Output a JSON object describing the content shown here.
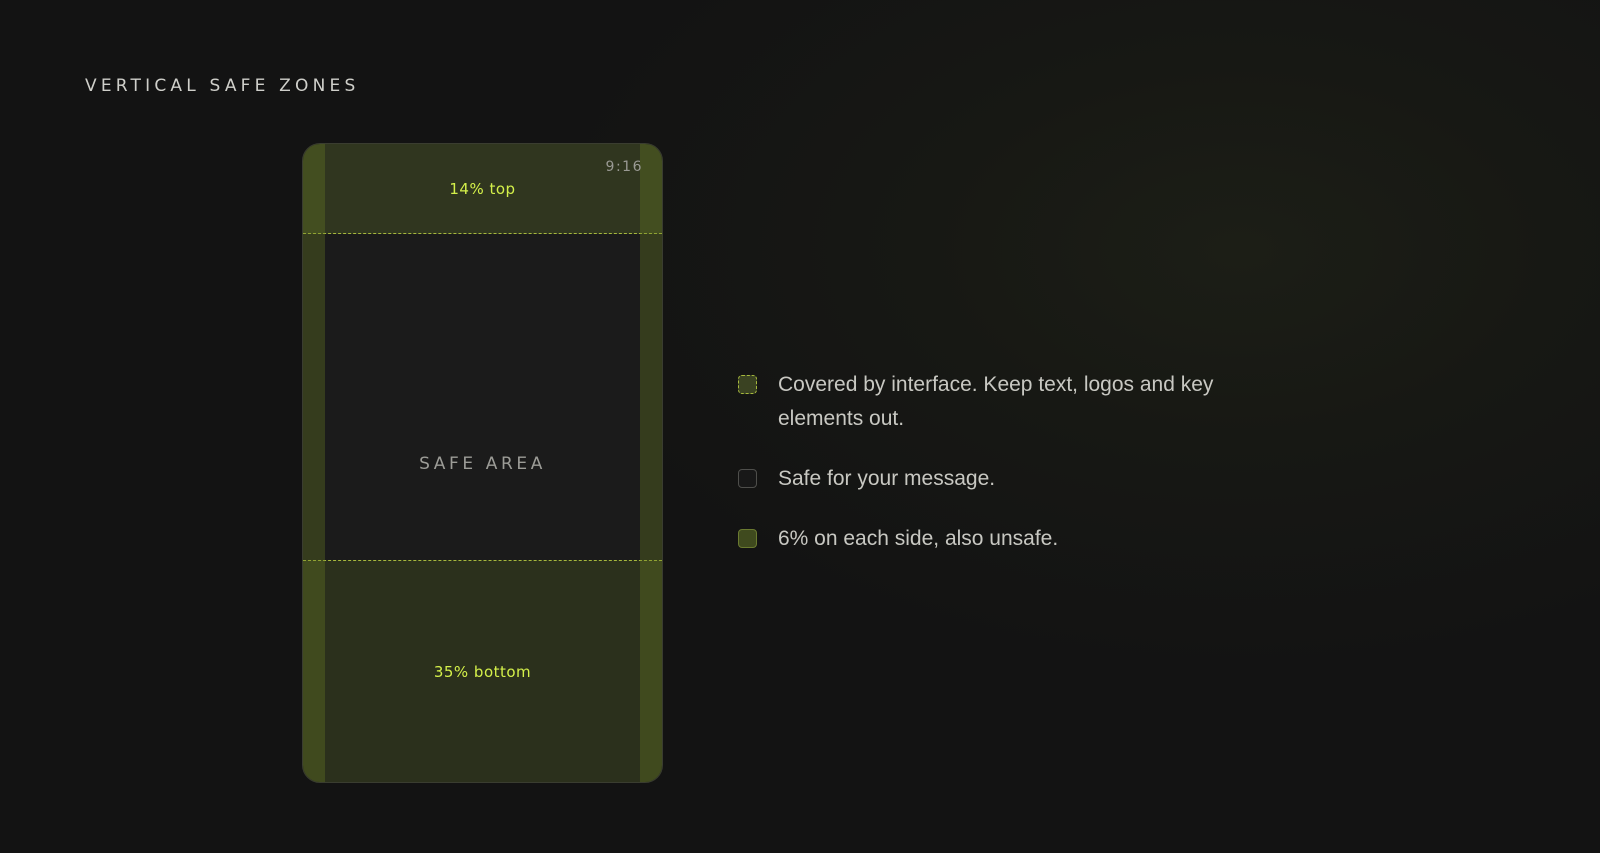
{
  "page": {
    "title": "VERTICAL SAFE ZONES"
  },
  "phone": {
    "aspect_ratio": "9:16",
    "top_zone_label": "14% top",
    "safe_area_label": "SAFE AREA",
    "bottom_zone_label": "35% bottom",
    "top_zone_percent": 14,
    "bottom_zone_percent": 35,
    "side_zone_percent": 6
  },
  "legend": {
    "items": [
      {
        "swatch": "covered-dashed",
        "text": "Covered by interface. Keep text, logos and key elements out."
      },
      {
        "swatch": "safe-outline",
        "text": "Safe for your message."
      },
      {
        "swatch": "side-filled",
        "text": "6% on each side, also unsafe."
      }
    ]
  },
  "colors": {
    "background": "#131313",
    "accent": "#d4f04a",
    "unsafe_zone": "#30361f",
    "dashed_line": "#a6b83d"
  }
}
